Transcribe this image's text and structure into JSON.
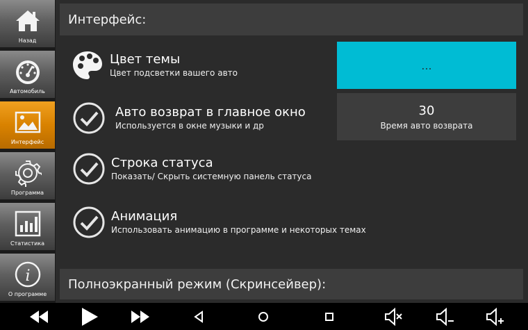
{
  "sidebar": {
    "items": [
      {
        "label": "Назад",
        "icon": "home-icon",
        "active": false
      },
      {
        "label": "Автомобиль",
        "icon": "gauge-icon",
        "active": false
      },
      {
        "label": "Интерфейс",
        "icon": "image-icon",
        "active": true
      },
      {
        "label": "Программа",
        "icon": "gear-icon",
        "active": false
      },
      {
        "label": "Статистика",
        "icon": "bar-chart-icon",
        "active": false
      },
      {
        "label": "О программе",
        "icon": "info-icon",
        "active": false
      }
    ]
  },
  "header": {
    "title": "Интерфейс:"
  },
  "settings": [
    {
      "title": "Цвет темы",
      "subtitle": "Цвет подсветки вашего авто",
      "icon": "palette-icon"
    },
    {
      "title": "Авто возврат в главное окно",
      "subtitle": "Используется в окне музыки и др",
      "icon": "check-circle-icon"
    },
    {
      "title": "Строка статуса",
      "subtitle": "Показать/ Скрыть системную панель статуса",
      "icon": "check-circle-icon"
    },
    {
      "title": "Анимация",
      "subtitle": "Использовать анимацию в программе и некоторых темах",
      "icon": "check-circle-icon"
    }
  ],
  "theme_color": {
    "label": "...",
    "color": "#00bcd4"
  },
  "auto_return": {
    "value": "30",
    "label": "Время авто возврата"
  },
  "footer": {
    "title": "Полноэкранный режим (Скринсейвер):"
  },
  "navbar": {
    "buttons": [
      "rewind-icon",
      "play-icon",
      "fast-forward-icon",
      "back-triangle-icon",
      "home-circle-icon",
      "recents-square-icon",
      "mute-icon",
      "volume-down-icon",
      "volume-up-icon"
    ]
  },
  "colors": {
    "accent": "#00bcd4",
    "active_tab": "#e08a00"
  }
}
